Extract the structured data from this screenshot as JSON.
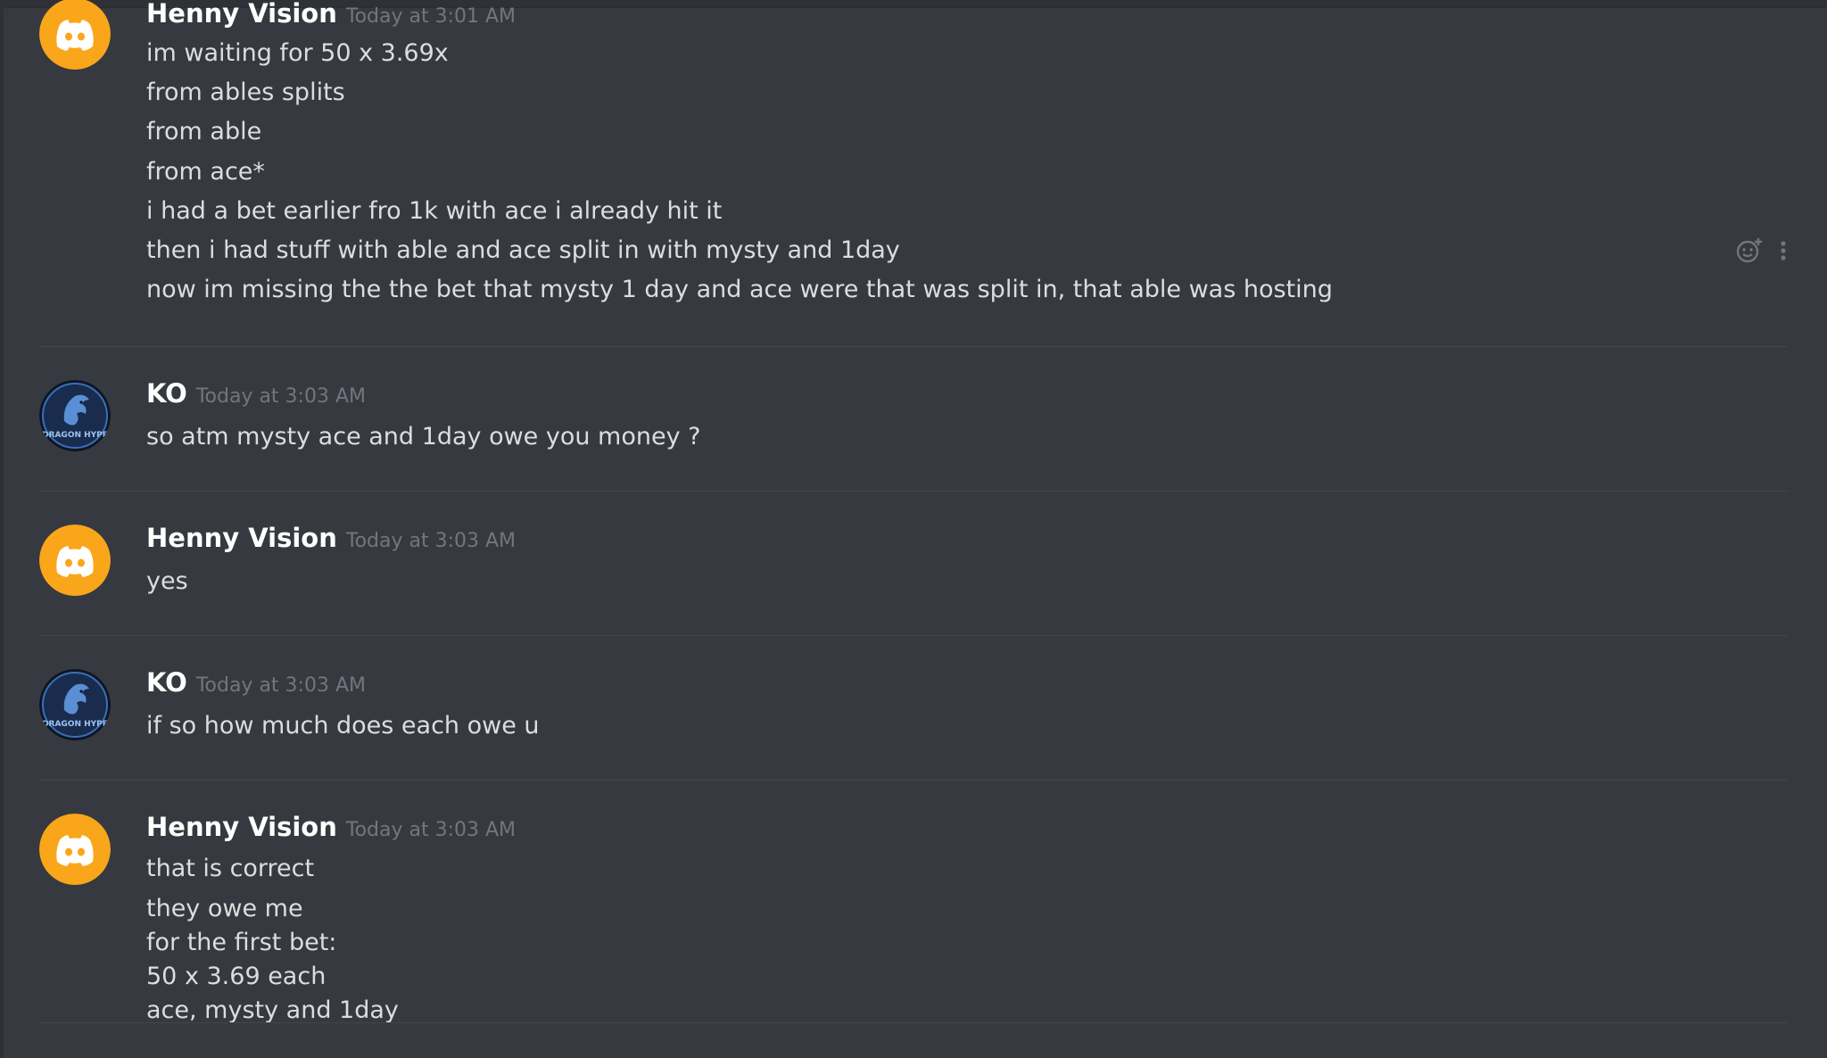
{
  "colors": {
    "background": "#36393f",
    "username": "#ffffff",
    "timestamp": "#72767d",
    "message_text": "#dcddde",
    "discord_avatar": "#faa61a",
    "dragon_avatar": "#1a2c4e"
  },
  "messages": [
    {
      "author": "Henny Vision",
      "timestamp": "Today at 3:01 AM",
      "avatar_icon": "discord-logo-icon",
      "lines": [
        "im waiting for 50 x 3.69x",
        "from ables splits",
        "from able",
        "from ace*",
        "i had a bet earlier fro 1k with ace i already hit it",
        "then i had stuff with able and ace split in with mysty and 1day",
        "now im missing the the bet that mysty 1 day and ace were that was split in, that able was hosting"
      ]
    },
    {
      "author": "KO",
      "timestamp": "Today at 3:03 AM",
      "avatar_icon": "dragon-hype-icon",
      "avatar_text": "DRAGON HYPE",
      "lines": [
        "so atm    mysty  ace and 1day owe you money ?"
      ]
    },
    {
      "author": "Henny Vision",
      "timestamp": "Today at 3:03 AM",
      "avatar_icon": "discord-logo-icon",
      "lines": [
        "yes"
      ]
    },
    {
      "author": "KO",
      "timestamp": "Today at 3:03 AM",
      "avatar_icon": "dragon-hype-icon",
      "avatar_text": "DRAGON HYPE",
      "lines": [
        "if so how much does each owe u"
      ]
    },
    {
      "author": "Henny Vision",
      "timestamp": "Today at 3:03 AM",
      "avatar_icon": "discord-logo-icon",
      "lines": [
        "that is correct",
        "they owe me",
        "for the first bet:",
        "50 x 3.69 each",
        "ace, mysty and 1day"
      ]
    }
  ],
  "hover_actions": {
    "icons": [
      "add-reaction-icon",
      "more-options-icon"
    ]
  }
}
